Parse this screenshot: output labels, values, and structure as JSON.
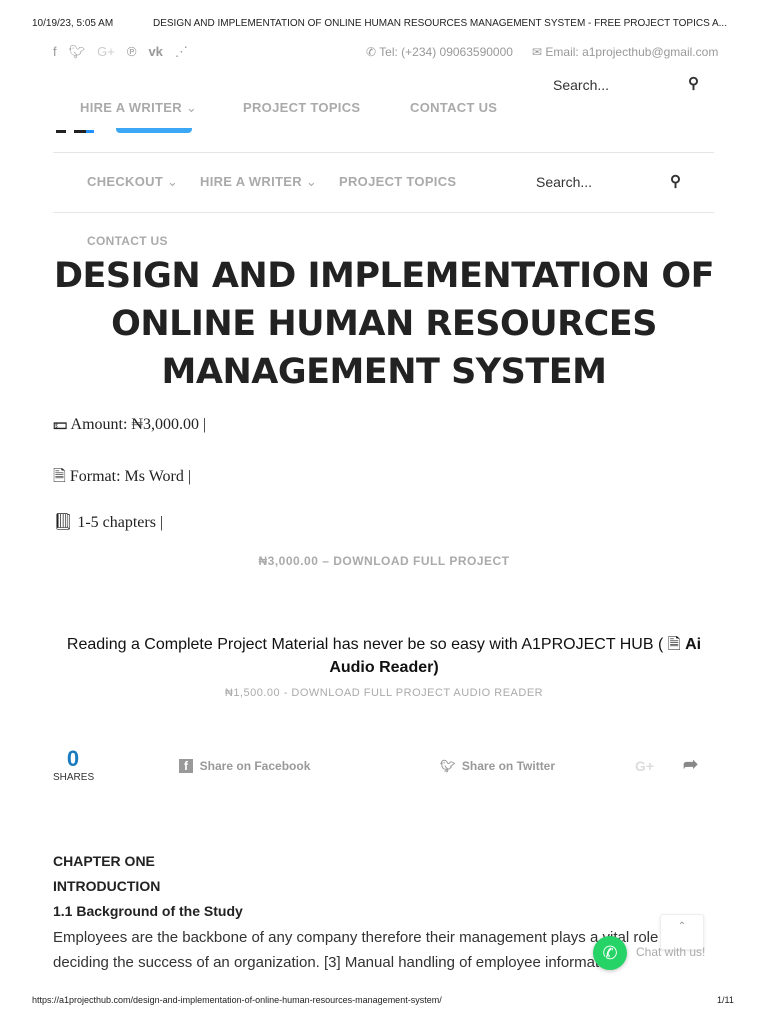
{
  "print_header": {
    "datetime": "10/19/23, 5:05 AM",
    "page_title": "DESIGN AND IMPLEMENTATION OF ONLINE HUMAN RESOURCES MANAGEMENT SYSTEM - FREE PROJECT TOPICS A..."
  },
  "topbar": {
    "social_icons": [
      "facebook-icon",
      "twitter-icon",
      "google-plus-icon",
      "pinterest-icon",
      "vk-icon",
      "rss-icon"
    ],
    "tel": "Tel: (+234) 09063590000",
    "email": "Email: a1projecthub@gmail.com"
  },
  "nav1": {
    "items": [
      "HIRE A WRITER",
      "PROJECT TOPICS",
      "CONTACT US"
    ],
    "search_placeholder": "Search..."
  },
  "nav2": {
    "items": [
      "CHECKOUT",
      "HIRE A WRITER",
      "PROJECT TOPICS",
      "CONTACT US"
    ],
    "search_placeholder": "Search..."
  },
  "article": {
    "title": "DESIGN AND IMPLEMENTATION OF ONLINE HUMAN RESOURCES MANAGEMENT SYSTEM",
    "amount": "Amount: ₦3,000.00 |",
    "format": "Format: Ms Word |",
    "chapters": "1-5 chapters |",
    "download_button": "₦3,000.00 – DOWNLOAD FULL PROJECT",
    "audio_text": "Reading a Complete Project Material has never be so easy with A1PROJECT HUB (",
    "audio_bold": "Ai Audio Reader)",
    "audio_download": "₦1,500.00 - DOWNLOAD FULL PROJECT AUDIO READER"
  },
  "share": {
    "count": "0",
    "count_label": "SHARES",
    "facebook": "Share on Facebook",
    "twitter": "Share on Twitter",
    "gplus": "G+"
  },
  "content": {
    "h1": "CHAPTER ONE",
    "h2": "INTRODUCTION",
    "h3": "1.1 Background of the Study",
    "p1": "Employees are the backbone of any company therefore their management plays a vital role in",
    "p2": "deciding the success of an organization. [3] Manual handling of employee information"
  },
  "chat": {
    "label": "Chat with us!",
    "color": "#25d366"
  },
  "print_footer": {
    "url": "https://a1projecthub.com/design-and-implementation-of-online-human-resources-management-system/",
    "page": "1/11"
  }
}
